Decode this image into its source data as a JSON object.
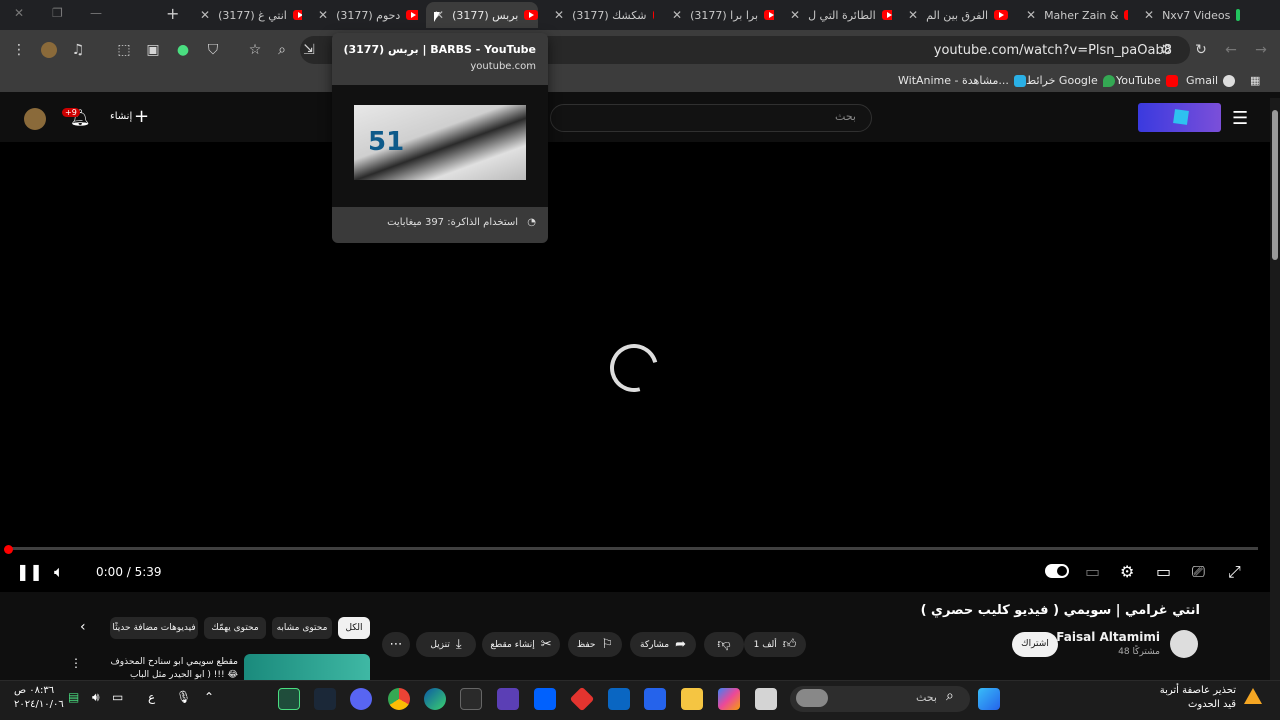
{
  "browser": {
    "tabs": [
      {
        "title": "(3177) انتي غ",
        "active": false
      },
      {
        "title": "(3177) دحوم",
        "active": false
      },
      {
        "title": "(3177) بربس",
        "active": true
      },
      {
        "title": "(3177) شكشك",
        "active": false
      },
      {
        "title": "(3177) برا برا",
        "active": false
      },
      {
        "title": "الطائرة التي ل",
        "active": false
      },
      {
        "title": "الفرق بين الم",
        "active": false
      },
      {
        "title": "Maher Zain &",
        "active": false
      },
      {
        "title": "Nxv7 Videos",
        "active": false
      }
    ],
    "url": "youtube.com/watch?v=Plsn_paOab8",
    "bookmarks": [
      "Gmail",
      "YouTube",
      "خرائط Google",
      "WitAnime - مشاهدة..."
    ]
  },
  "hovercard": {
    "title": "(3177) بربس | BARBS - YouTube",
    "domain": "youtube.com",
    "thumb_text": "51",
    "memory": "استخدام الذاكرة: 397 ميغابايت"
  },
  "youtube": {
    "search_placeholder": "بحث",
    "create_label": "إنشاء",
    "notif_badge": "+9",
    "player": {
      "time": "0:00 / 5:39",
      "progress": 0.0
    },
    "video": {
      "title": "انتي غرامي | سويمي ( فيديو كليب حصري )",
      "channel": "Faisal Altamimi",
      "subscribers": "48 مشتركًا",
      "subscribe_label": "اشتراك",
      "likes": "1 ألف",
      "share_label": "مشاركة",
      "save_label": "حفظ",
      "clip_label": "إنشاء مقطع",
      "download_label": "تنزيل"
    },
    "chips": [
      "الكل",
      "محتوى مشابه",
      "محتوى يهمّك",
      "فيديوهات مضافة حديثًا"
    ],
    "related": {
      "title": "مقطع سويمي ابو سنادح المحذوف !!! ( ابو الحيدر مثل الباب 😂"
    }
  },
  "taskbar": {
    "search_label": "بحث",
    "weather_line1": "تحذير عاصفة أتربة",
    "weather_line2": "قيد الحدوث",
    "clock_time": "٠٨:٣٦ ص",
    "clock_date": "٢٠٢٤/١٠/٠٦",
    "lang": "ع"
  }
}
